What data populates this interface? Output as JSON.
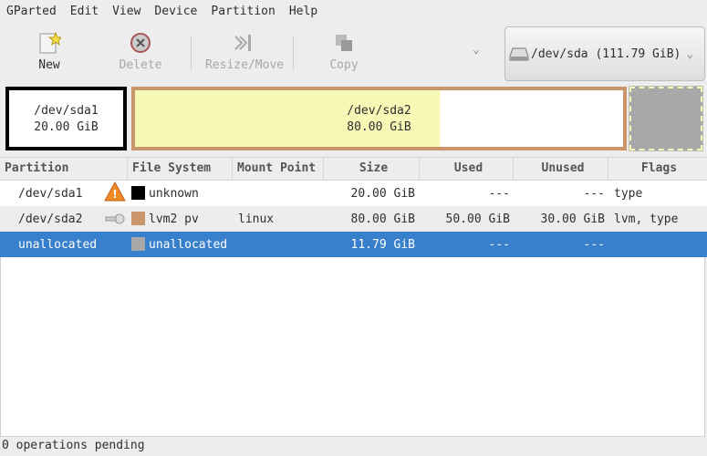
{
  "menu": [
    "GParted",
    "Edit",
    "View",
    "Device",
    "Partition",
    "Help"
  ],
  "toolbar": {
    "new": "New",
    "delete": "Delete",
    "resize": "Resize/Move",
    "copy": "Copy"
  },
  "device": {
    "label": "/dev/sda (111.79 GiB)"
  },
  "diskmap": [
    {
      "name": "/dev/sda1",
      "size": "20.00 GiB",
      "color": "#000000"
    },
    {
      "name": "/dev/sda2",
      "size": "80.00 GiB",
      "color": "#c8966a",
      "used_fraction": 0.625
    },
    {
      "name": "unallocated",
      "color": "#a8a8a8"
    }
  ],
  "columns": [
    "Partition",
    "File System",
    "Mount Point",
    "Size",
    "Used",
    "Unused",
    "Flags"
  ],
  "rows": [
    {
      "partition": "/dev/sda1",
      "icon": "warning-icon",
      "fs": "unknown",
      "fs_color": "#000000",
      "mount": "",
      "size": "20.00 GiB",
      "used": "---",
      "unused": "---",
      "flags": "type"
    },
    {
      "partition": "/dev/sda2",
      "icon": "key-icon",
      "fs": "lvm2 pv",
      "fs_color": "#c8966a",
      "mount": "linux",
      "size": "80.00 GiB",
      "used": "50.00 GiB",
      "unused": "30.00 GiB",
      "flags": "lvm, type"
    },
    {
      "partition": "unallocated",
      "icon": "",
      "fs": "unallocated",
      "fs_color": "#a8a8a8",
      "mount": "",
      "size": "11.79 GiB",
      "used": "---",
      "unused": "---",
      "flags": ""
    }
  ],
  "status": "0 operations pending"
}
